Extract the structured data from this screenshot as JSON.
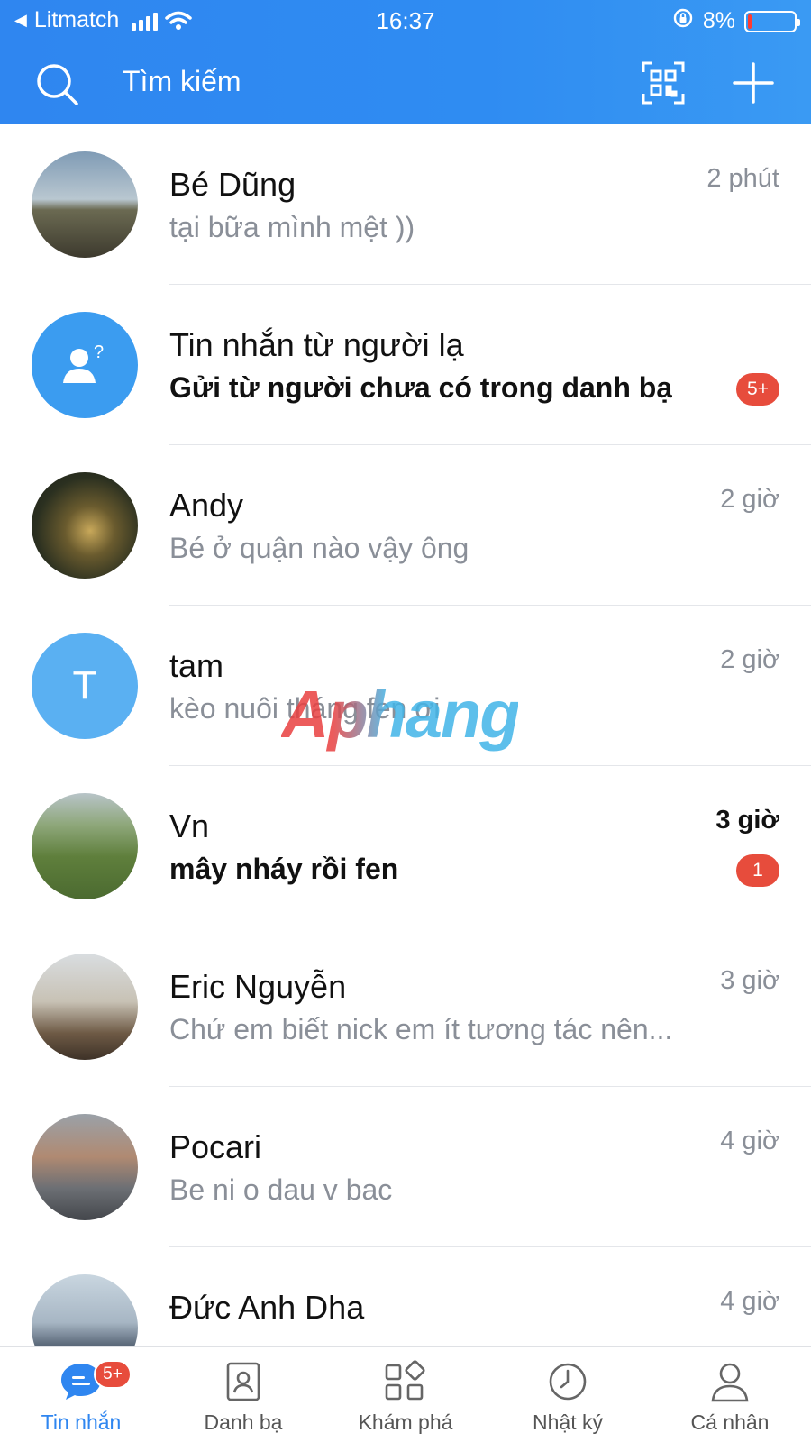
{
  "status_bar": {
    "back_app": "Litmatch",
    "time": "16:37",
    "battery_percent": "8%"
  },
  "header": {
    "search_placeholder": "Tìm kiếm",
    "icons": [
      "search-icon",
      "qr-code-icon",
      "plus-icon"
    ]
  },
  "conversations": [
    {
      "name": "Bé Dũng",
      "preview": "tại bữa mình mệt ))",
      "time": "2 phút",
      "unread": false,
      "badge": "",
      "avatar_color": "#8aa0b0"
    },
    {
      "name": "Tin nhắn từ người lạ",
      "preview": "Gửi từ người chưa có trong danh bạ",
      "time": "",
      "unread": true,
      "badge": "5+",
      "avatar_color": "#3b9cf0"
    },
    {
      "name": "Andy",
      "preview": "Bé ở quận nào vậy ông",
      "time": "2 giờ",
      "unread": false,
      "badge": "",
      "avatar_color": "#3a4230"
    },
    {
      "name": "tam",
      "preview": "kèo nuôi tháng fen ơi",
      "time": "2 giờ",
      "unread": false,
      "badge": "",
      "avatar_color": "#5ab0f2",
      "avatar_letter": "T"
    },
    {
      "name": "Vn",
      "preview": "mây nháy rồi fen",
      "time": "3 giờ",
      "unread": true,
      "badge": "1",
      "avatar_color": "#6f8f4e"
    },
    {
      "name": "Eric Nguyễn",
      "preview": "Chứ em biết nick em ít tương tác nên...",
      "time": "3 giờ",
      "unread": false,
      "badge": "",
      "avatar_color": "#a89a85"
    },
    {
      "name": "Pocari",
      "preview": "Be ni o dau v bac",
      "time": "4 giờ",
      "unread": false,
      "badge": "",
      "avatar_color": "#7c8088"
    },
    {
      "name": "Đức Anh Dha",
      "preview": "",
      "time": "4 giờ",
      "unread": false,
      "badge": "",
      "avatar_color": "#a7b6c4"
    }
  ],
  "watermark": "Aphang",
  "bottom_nav": [
    {
      "label": "Tin nhắn",
      "active": true,
      "badge": "5+"
    },
    {
      "label": "Danh bạ",
      "active": false
    },
    {
      "label": "Khám phá",
      "active": false
    },
    {
      "label": "Nhật ký",
      "active": false
    },
    {
      "label": "Cá nhân",
      "active": false
    }
  ],
  "colors": {
    "header_blue": "#2f86f0",
    "badge_red": "#e74c3c",
    "muted_text": "#8a8f98"
  }
}
